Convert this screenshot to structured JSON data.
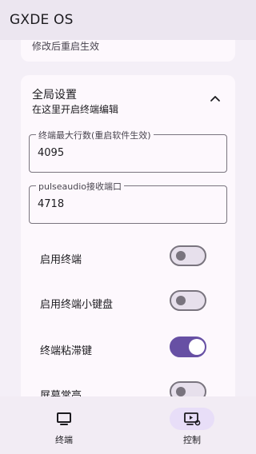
{
  "app": {
    "title": "GXDE OS"
  },
  "top_card": {
    "text": "修改后重启生效"
  },
  "section": {
    "title": "全局设置",
    "subtitle": "在这里开启终端编辑",
    "collapse_icon": "chevron-up-icon"
  },
  "fields": [
    {
      "label": "终端最大行数(重启软件生效)",
      "value": "4095"
    },
    {
      "label": "pulseaudio接收端口",
      "value": "4718"
    }
  ],
  "toggles": [
    {
      "label": "启用终端",
      "on": false
    },
    {
      "label": "启用终端小键盘",
      "on": false
    },
    {
      "label": "终端粘滞键",
      "on": true
    },
    {
      "label": "屏幕常亮",
      "on": false
    }
  ],
  "nav": {
    "items": [
      {
        "label": "终端",
        "icon": "monitor-icon",
        "active": false
      },
      {
        "label": "控制",
        "icon": "screen-play-icon",
        "active": true
      }
    ]
  },
  "colors": {
    "accent": "#6750a4",
    "active_pill": "#e8def8",
    "background": "#f4eff7",
    "surface": "#fdf8fd"
  }
}
